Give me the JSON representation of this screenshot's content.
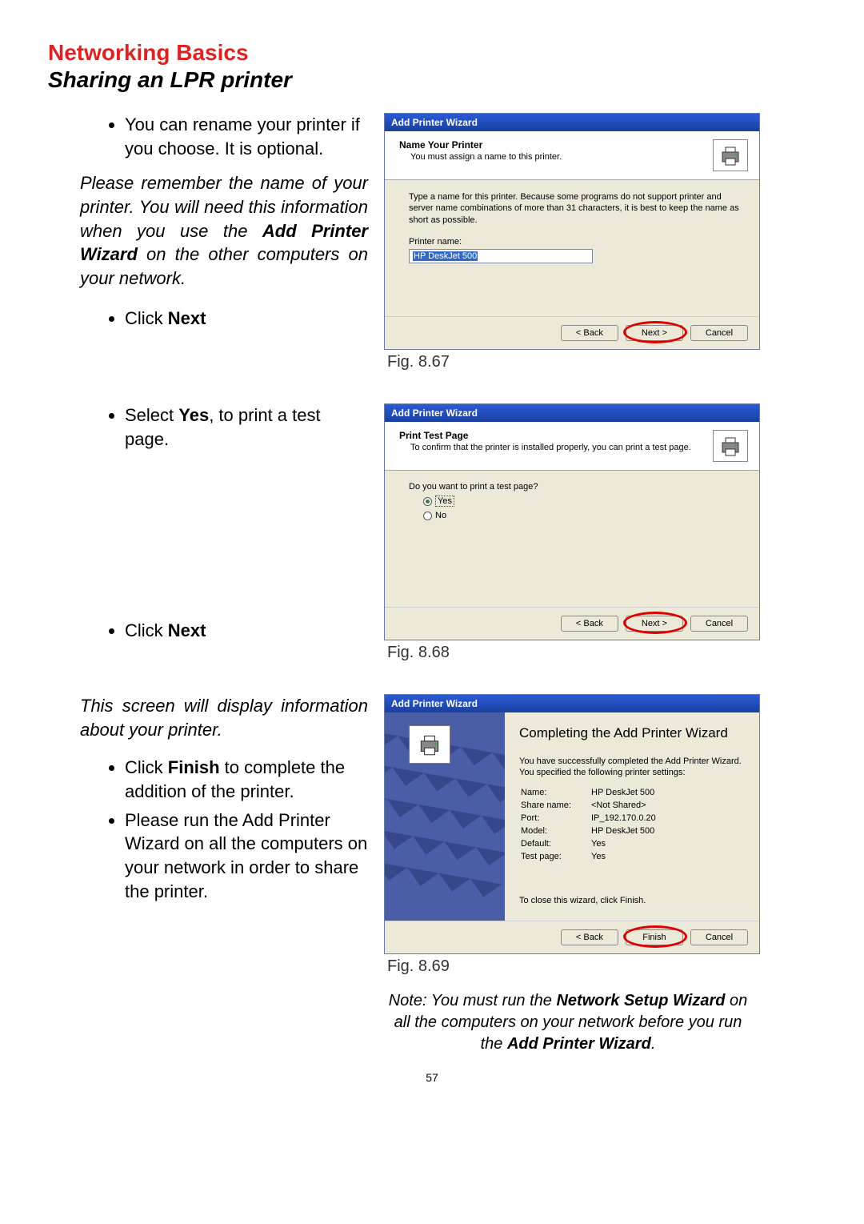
{
  "title1": "Networking Basics",
  "title2": "Sharing an LPR printer",
  "left": {
    "bullet1": "You can rename your printer if you choose.  It is optional.",
    "note1": "Please remember the name of your printer.  You will need this information when you use the ",
    "note1b": "Add Printer Wizard",
    "note1c": " on the other computers on your network.",
    "bullet2a": "Click ",
    "bullet2b": "Next",
    "bullet3a": "Select ",
    "bullet3b": "Yes",
    "bullet3c": ", to print a test page.",
    "bullet4a": "Click ",
    "bullet4b": "Next",
    "note2": "This screen will display information about your printer.",
    "bullet5a": "Click ",
    "bullet5b": "Finish",
    "bullet5c": " to complete the addition of the printer.",
    "bullet6": "Please run the Add Printer Wizard on all the computers on your network in order to share the printer."
  },
  "wizard": {
    "title": "Add Printer Wizard",
    "fig1": {
      "head1": "Name Your Printer",
      "head2": "You must assign a name to this printer.",
      "body": "Type a name for this printer. Because some programs do not support printer and server name combinations of more than 31 characters, it is best to keep the name as short as possible.",
      "label": "Printer name:",
      "value": "HP DeskJet 500",
      "caption": "Fig. 8.67"
    },
    "fig2": {
      "head1": "Print Test Page",
      "head2": "To confirm that the printer is installed properly, you can print a test page.",
      "question": "Do you want to print a test page?",
      "yes": "Yes",
      "no": "No",
      "caption": "Fig. 8.68"
    },
    "fig3": {
      "title": "Completing the Add Printer Wizard",
      "desc": "You have successfully completed the Add Printer Wizard. You specified the following printer settings:",
      "settings": {
        "name_l": "Name:",
        "name_v": "HP DeskJet 500",
        "share_l": "Share name:",
        "share_v": "<Not Shared>",
        "port_l": "Port:",
        "port_v": "IP_192.170.0.20",
        "model_l": "Model:",
        "model_v": "HP DeskJet 500",
        "default_l": "Default:",
        "default_v": "Yes",
        "test_l": "Test page:",
        "test_v": "Yes"
      },
      "close": "To close this wizard, click Finish.",
      "caption": "Fig. 8.69"
    },
    "btn_back": "< Back",
    "btn_next": "Next >",
    "btn_cancel": "Cancel",
    "btn_finish": "Finish"
  },
  "footnote": {
    "pre": "Note:  You must run the ",
    "b1": "Network Setup Wizard",
    "mid": " on all the computers on your network before you run the ",
    "b2": "Add Printer Wizard",
    "end": "."
  },
  "page": "57"
}
